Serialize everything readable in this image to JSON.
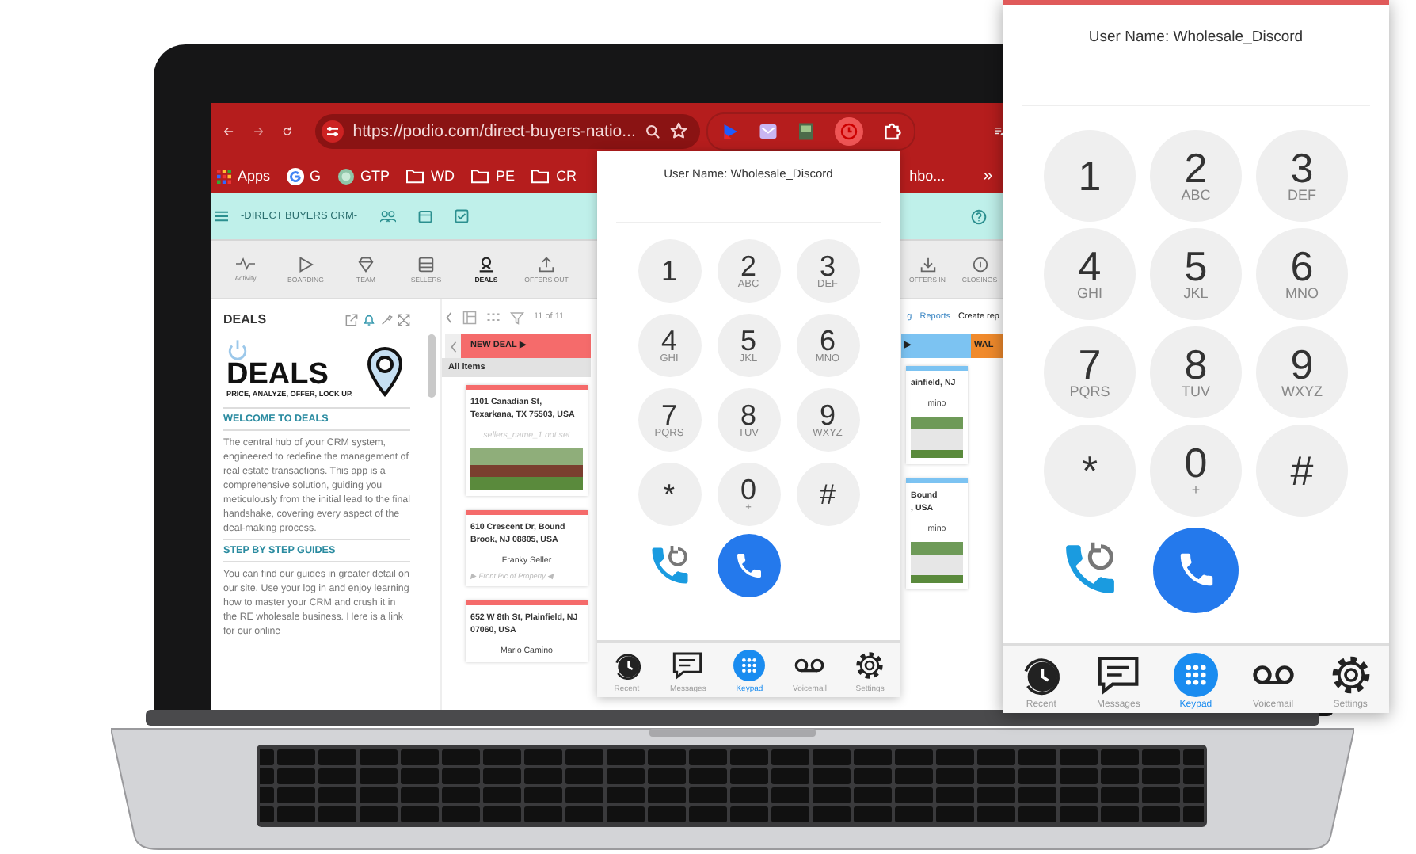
{
  "browser": {
    "url": "https://podio.com/direct-buyers-natio...",
    "bookmarks": [
      {
        "label": "Apps",
        "kind": "apps"
      },
      {
        "label": "G",
        "kind": "google"
      },
      {
        "label": "GTP",
        "kind": "site"
      },
      {
        "label": "WD",
        "kind": "folder"
      },
      {
        "label": "PE",
        "kind": "folder"
      },
      {
        "label": "CR",
        "kind": "folder"
      },
      {
        "label": "hbo...",
        "kind": "plain"
      }
    ],
    "bookmarks_overflow": "»"
  },
  "workspace": {
    "title": "-DIRECT BUYERS CRM-"
  },
  "app_tabs": [
    {
      "label": "Activity",
      "kind": "activity",
      "selected": false
    },
    {
      "label": "BOARDING",
      "kind": "boarding",
      "selected": false
    },
    {
      "label": "TEAM",
      "kind": "team",
      "selected": false
    },
    {
      "label": "SELLERS",
      "kind": "sellers",
      "selected": false
    },
    {
      "label": "DEALS",
      "kind": "deals",
      "selected": true
    },
    {
      "label": "OFFERS OUT",
      "kind": "offers_out",
      "selected": false
    },
    {
      "label": "OFFERS IN",
      "kind": "offers_in",
      "selected": false
    },
    {
      "label": "CLOSINGS",
      "kind": "closings",
      "selected": false
    }
  ],
  "sidebar": {
    "title": "DEALS",
    "logo_text": "DEALS",
    "logo_tagline": "PRICE, ANALYZE, OFFER, LOCK UP.",
    "sections": [
      {
        "heading": "WELCOME TO DEALS",
        "text": "The central hub of your CRM system, engineered to redefine the management of real estate transactions. This app is a comprehensive solution, guiding you meticulously from the initial lead to the final handshake, covering every aspect of the deal-making process."
      },
      {
        "heading": "STEP BY STEP GUIDES",
        "text": "You can find our guides in greater detail on our site. Use your log in and enjoy learning how to master your CRM and crush it in the RE wholesale business. Here is a link for our online"
      }
    ]
  },
  "board": {
    "count": "11 of 11",
    "links": [
      "g",
      "Reports"
    ],
    "create_label": "Create rep",
    "columns": [
      {
        "title": "NEW DEAL ▶",
        "color": "#f56b6b",
        "subtitle": "All items",
        "cards": [
          {
            "address": [
              "1101 Canadian St,",
              "Texarkana, TX 75503, USA"
            ],
            "seller": "sellers_name_1 not set",
            "seller_set": false,
            "photo": true
          },
          {
            "address": [
              "610 Crescent Dr, Bound",
              "Brook, NJ 08805, USA"
            ],
            "seller": "Franky Seller",
            "seller_set": true,
            "photo": false,
            "file": "▶ Front Pic of Property ◀"
          },
          {
            "address": [
              "652 W 8th St, Plainfield, NJ",
              "07060, USA"
            ],
            "seller": "Mario Camino",
            "seller_set": true,
            "photo": false
          }
        ]
      },
      {
        "title": "▶",
        "color": "#7cc3f2",
        "cards": [
          {
            "address": [
              "ainfield, NJ"
            ],
            "seller": "mino",
            "seller_set": true,
            "photo": true
          },
          {
            "address": [
              "Bound",
              ", USA"
            ],
            "seller": "mino",
            "seller_set": true,
            "photo": true
          }
        ]
      },
      {
        "title": "WAL",
        "color": "#f08a2c"
      }
    ]
  },
  "dialer_popup": {
    "user": "User Name: Wholesale_Discord",
    "keys": [
      {
        "digit": "1"
      },
      {
        "digit": "2",
        "letters": "ABC"
      },
      {
        "digit": "3",
        "letters": "DEF"
      },
      {
        "digit": "4",
        "letters": "GHI"
      },
      {
        "digit": "5",
        "letters": "JKL"
      },
      {
        "digit": "6",
        "letters": "MNO"
      },
      {
        "digit": "7",
        "letters": "PQRS"
      },
      {
        "digit": "8",
        "letters": "TUV"
      },
      {
        "digit": "9",
        "letters": "WXYZ"
      },
      {
        "digit": "*"
      },
      {
        "digit": "0",
        "letters": "+"
      },
      {
        "digit": "#"
      }
    ],
    "nav": [
      {
        "label": "Recent",
        "kind": "recent",
        "selected": false
      },
      {
        "label": "Messages",
        "kind": "messages",
        "selected": false
      },
      {
        "label": "Keypad",
        "kind": "keypad",
        "selected": true
      },
      {
        "label": "Voicemail",
        "kind": "voicemail",
        "selected": false
      },
      {
        "label": "Settings",
        "kind": "settings",
        "selected": false
      }
    ]
  },
  "dialer_zoom": {
    "user": "User Name: Wholesale_Discord",
    "keys": [
      {
        "digit": "1"
      },
      {
        "digit": "2",
        "letters": "ABC"
      },
      {
        "digit": "3",
        "letters": "DEF"
      },
      {
        "digit": "4",
        "letters": "GHI"
      },
      {
        "digit": "5",
        "letters": "JKL"
      },
      {
        "digit": "6",
        "letters": "MNO"
      },
      {
        "digit": "7",
        "letters": "PQRS"
      },
      {
        "digit": "8",
        "letters": "TUV"
      },
      {
        "digit": "9",
        "letters": "WXYZ"
      },
      {
        "digit": "*"
      },
      {
        "digit": "0",
        "letters": "+"
      },
      {
        "digit": "#"
      }
    ],
    "nav": [
      {
        "label": "Recent",
        "kind": "recent",
        "selected": false
      },
      {
        "label": "Messages",
        "kind": "messages",
        "selected": false
      },
      {
        "label": "Keypad",
        "kind": "keypad",
        "selected": true
      },
      {
        "label": "Voicemail",
        "kind": "voicemail",
        "selected": false
      },
      {
        "label": "Settings",
        "kind": "settings",
        "selected": false
      }
    ]
  }
}
